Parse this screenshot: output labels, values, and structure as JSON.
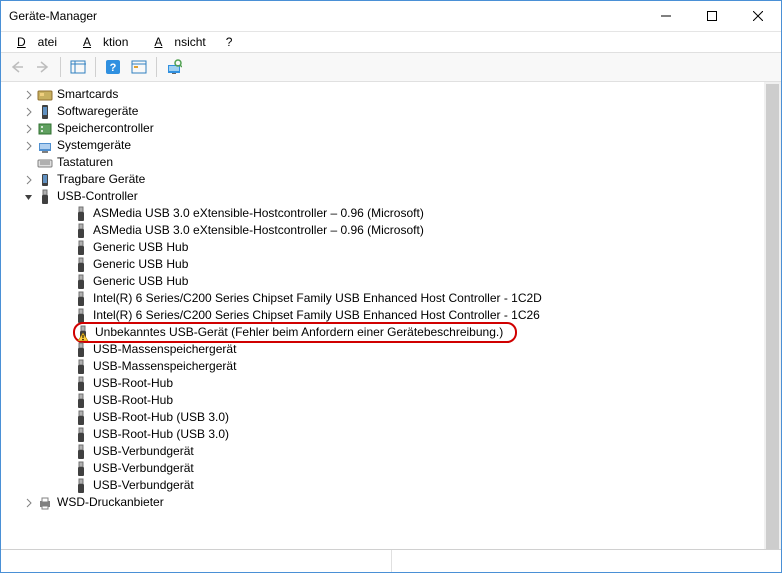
{
  "window": {
    "title": "Geräte-Manager"
  },
  "menu": {
    "file": "Datei",
    "action": "Aktion",
    "view": "Ansicht",
    "help": "?"
  },
  "tree": {
    "categories": [
      {
        "label": "Smartcards",
        "icon": "card",
        "expanded": false
      },
      {
        "label": "Softwaregeräte",
        "icon": "software",
        "expanded": false
      },
      {
        "label": "Speichercontroller",
        "icon": "storage",
        "expanded": false
      },
      {
        "label": "Systemgeräte",
        "icon": "system",
        "expanded": false
      },
      {
        "label": "Tastaturen",
        "icon": "keyboard",
        "expanded": false,
        "noarrow": true
      },
      {
        "label": "Tragbare Geräte",
        "icon": "portable",
        "expanded": false
      },
      {
        "label": "USB-Controller",
        "icon": "usb",
        "expanded": true,
        "children": [
          {
            "label": "ASMedia USB 3.0 eXtensible-Hostcontroller – 0.96 (Microsoft)",
            "icon": "usb",
            "warn": false
          },
          {
            "label": "ASMedia USB 3.0 eXtensible-Hostcontroller – 0.96 (Microsoft)",
            "icon": "usb",
            "warn": false
          },
          {
            "label": "Generic USB Hub",
            "icon": "usb",
            "warn": false
          },
          {
            "label": "Generic USB Hub",
            "icon": "usb",
            "warn": false
          },
          {
            "label": "Generic USB Hub",
            "icon": "usb",
            "warn": false
          },
          {
            "label": "Intel(R) 6 Series/C200 Series Chipset Family USB Enhanced Host Controller - 1C2D",
            "icon": "usb",
            "warn": false
          },
          {
            "label": "Intel(R) 6 Series/C200 Series Chipset Family USB Enhanced Host Controller - 1C26",
            "icon": "usb",
            "warn": false
          },
          {
            "label": "Unbekanntes USB-Gerät (Fehler beim Anfordern einer Gerätebeschreibung.)",
            "icon": "usb",
            "warn": true,
            "highlight": true
          },
          {
            "label": "USB-Massenspeichergerät",
            "icon": "usb",
            "warn": false
          },
          {
            "label": "USB-Massenspeichergerät",
            "icon": "usb",
            "warn": false
          },
          {
            "label": "USB-Root-Hub",
            "icon": "usb",
            "warn": false
          },
          {
            "label": "USB-Root-Hub",
            "icon": "usb",
            "warn": false
          },
          {
            "label": "USB-Root-Hub (USB 3.0)",
            "icon": "usb",
            "warn": false
          },
          {
            "label": "USB-Root-Hub (USB 3.0)",
            "icon": "usb",
            "warn": false
          },
          {
            "label": "USB-Verbundgerät",
            "icon": "usb",
            "warn": false
          },
          {
            "label": "USB-Verbundgerät",
            "icon": "usb",
            "warn": false
          },
          {
            "label": "USB-Verbundgerät",
            "icon": "usb",
            "warn": false
          }
        ]
      },
      {
        "label": "WSD-Druckanbieter",
        "icon": "printer",
        "expanded": false
      }
    ]
  }
}
